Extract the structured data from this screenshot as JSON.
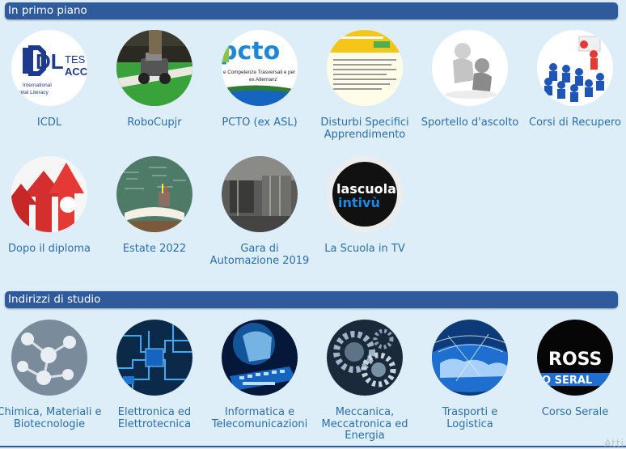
{
  "sections": {
    "featured": {
      "title": "In primo piano",
      "items": [
        {
          "label": "ICDL",
          "icon": "icdl-logo-icon"
        },
        {
          "label": "RoboCupjr",
          "icon": "robot-photo-icon"
        },
        {
          "label": "PCTO (ex ASL)",
          "icon": "pcto-logo-icon"
        },
        {
          "label": "Disturbi Specifici Apprendimento",
          "icon": "document-icon"
        },
        {
          "label": "Sportello d'ascolto",
          "icon": "listening-figures-icon"
        },
        {
          "label": "Corsi di Recupero",
          "icon": "classroom-figures-icon"
        },
        {
          "label": "Dopo il diploma",
          "icon": "red-arrows-icon"
        },
        {
          "label": "Estate 2022",
          "icon": "books-blackboard-icon"
        },
        {
          "label": "Gara di Automazione 2019",
          "icon": "automation-photo-icon"
        },
        {
          "label": "La Scuola in TV",
          "icon": "la-scuola-in-tivu-logo-icon"
        }
      ],
      "logo_text": {
        "icdl_main": "DL",
        "icdl_side": "TES",
        "icdl_side2": "ACC",
        "icdl_line1": "International",
        "icdl_line2": "igital Literacy",
        "pcto": "pcto",
        "pcto_line1": "e Competenze Trasversali e per",
        "pcto_line2": "ex Alternanz",
        "tv_line1": "lascuola",
        "tv_line2": "intivù"
      }
    },
    "courses": {
      "title": "Indirizzi di studio",
      "items": [
        {
          "label": "Chimica, Materiali e Biotecnologie",
          "icon": "molecules-icon"
        },
        {
          "label": "Elettronica ed Elettrotecnica",
          "icon": "circuit-board-icon"
        },
        {
          "label": "Informatica e Telecomunicazioni",
          "icon": "keyboard-icon"
        },
        {
          "label": "Meccanica, Meccatronica ed Energia",
          "icon": "gears-icon"
        },
        {
          "label": "Trasporti e Logistica",
          "icon": "globe-network-icon"
        },
        {
          "label": "Corso Serale",
          "icon": "corso-serale-logo-icon"
        }
      ],
      "logo_text": {
        "serale_line1": "ROSS",
        "serale_line2": "O SERAL"
      }
    }
  },
  "watermark": "Atti",
  "colors": {
    "page_background": "#ddeef8",
    "section_bar": "#2f5a9c",
    "link_text": "#2a6ea8"
  }
}
